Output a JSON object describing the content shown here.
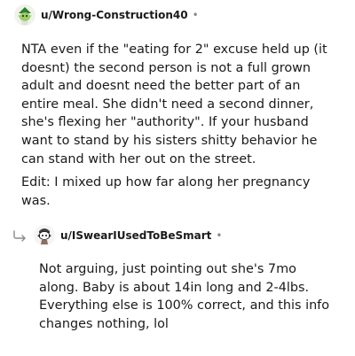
{
  "comments": [
    {
      "username": "u/Wrong-Construction40",
      "separator": "•",
      "avatar_icon": "goblin-avatar-icon",
      "paragraphs": [
        "NTA even if the \"eating for 2\" excuse held up (it doesnt) the second person is not a full grown adult and doesnt need the better part of an entire meal. She didn't need a second dinner, she's flexing her \"authority\". If your husband want to stand by his sisters shitty behavior he can stand with her out on the street.",
        "Edit: I mixed up how far along her pregnancy was."
      ]
    },
    {
      "username": "u/ISwearIUsedToBeSmart",
      "separator": "•",
      "avatar_icon": "snoo-avatar-icon",
      "reply_icon": "reply-arrow-icon",
      "paragraphs": [
        "Not arguing, just pointing out she's 7mo along. Baby is about 14in long and 2-4lbs. Everything else is 100% correct, and this info changes nothing, lol"
      ]
    }
  ],
  "colors": {
    "text": "#1a1a1b",
    "muted": "#878a8c",
    "background": "#ffffff"
  }
}
